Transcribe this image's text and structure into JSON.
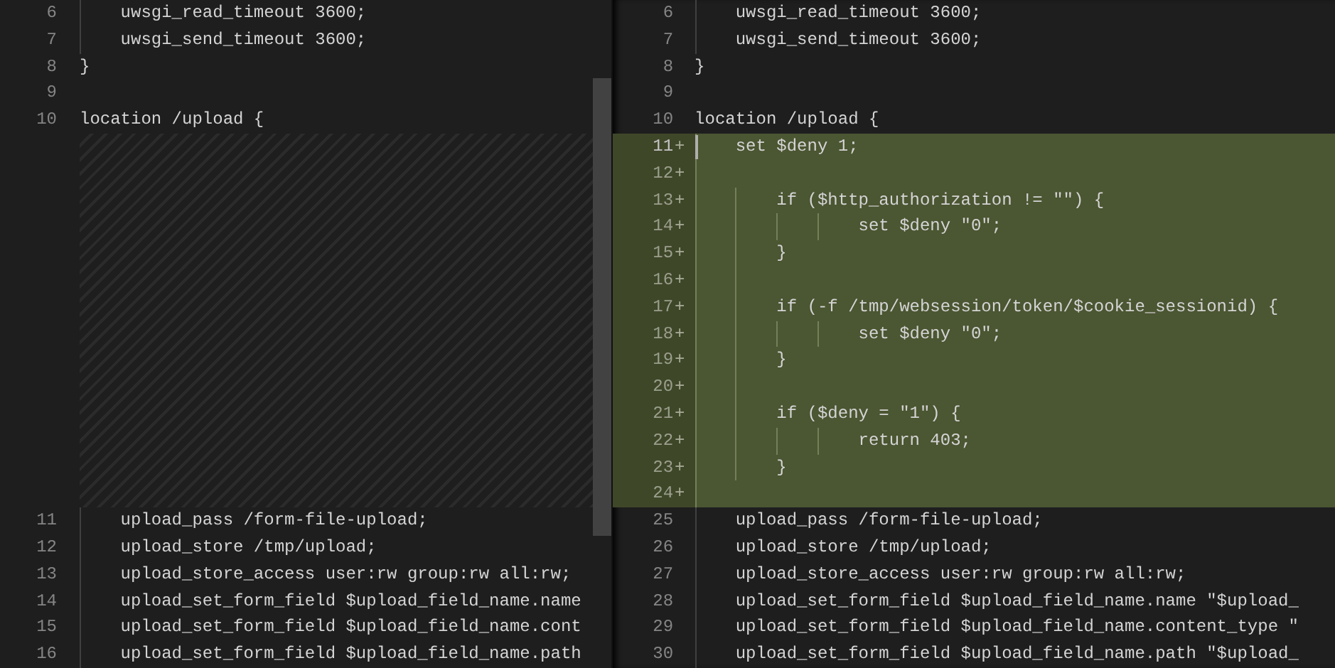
{
  "left": {
    "lines": [
      {
        "kind": "line",
        "number": "6",
        "text": "    uwsgi_read_timeout 3600;"
      },
      {
        "kind": "line",
        "number": "7",
        "text": "    uwsgi_send_timeout 3600;"
      },
      {
        "kind": "line",
        "number": "8",
        "text": "}"
      },
      {
        "kind": "line",
        "number": "9"
      },
      {
        "kind": "line",
        "number": "10",
        "text": "location /upload {"
      },
      {
        "kind": "gap"
      },
      {
        "kind": "line",
        "number": "11",
        "text": "    upload_pass /form-file-upload;"
      },
      {
        "kind": "line",
        "number": "12",
        "text": "    upload_store /tmp/upload;"
      },
      {
        "kind": "line",
        "number": "13",
        "text": "    upload_store_access user:rw group:rw all:rw;"
      },
      {
        "kind": "line",
        "number": "14",
        "text": "    upload_set_form_field $upload_field_name.name"
      },
      {
        "kind": "line",
        "number": "15",
        "text": "    upload_set_form_field $upload_field_name.cont"
      },
      {
        "kind": "line",
        "number": "16",
        "text": "    upload_set_form_field $upload_field_name.path"
      }
    ]
  },
  "right": {
    "lines": [
      {
        "number": "6",
        "text": "    uwsgi_read_timeout 3600;",
        "added": false,
        "cursor": false
      },
      {
        "number": "7",
        "text": "    uwsgi_send_timeout 3600;",
        "added": false,
        "cursor": false
      },
      {
        "number": "8",
        "text": "}",
        "added": false,
        "cursor": false
      },
      {
        "number": "9",
        "added": false,
        "cursor": false
      },
      {
        "number": "10",
        "text": "location /upload {",
        "added": false,
        "cursor": false
      },
      {
        "number": "11",
        "marker": "+",
        "text": "    set $deny 1;",
        "added": true,
        "cursor": true
      },
      {
        "number": "12",
        "marker": "+",
        "added": true,
        "cursor": false
      },
      {
        "number": "13",
        "marker": "+",
        "text": "        if ($http_authorization != \"\") {",
        "added": true,
        "cursor": false
      },
      {
        "number": "14",
        "marker": "+",
        "text": "                set $deny \"0\";",
        "added": true,
        "cursor": false
      },
      {
        "number": "15",
        "marker": "+",
        "text": "        }",
        "added": true,
        "cursor": false
      },
      {
        "number": "16",
        "marker": "+",
        "added": true,
        "cursor": false
      },
      {
        "number": "17",
        "marker": "+",
        "text": "        if (-f /tmp/websession/token/$cookie_sessionid) {",
        "added": true,
        "cursor": false
      },
      {
        "number": "18",
        "marker": "+",
        "text": "                set $deny \"0\";",
        "added": true,
        "cursor": false
      },
      {
        "number": "19",
        "marker": "+",
        "text": "        }",
        "added": true,
        "cursor": false
      },
      {
        "number": "20",
        "marker": "+",
        "added": true,
        "cursor": false
      },
      {
        "number": "21",
        "marker": "+",
        "text": "        if ($deny = \"1\") {",
        "added": true,
        "cursor": false
      },
      {
        "number": "22",
        "marker": "+",
        "text": "                return 403;",
        "added": true,
        "cursor": false
      },
      {
        "number": "23",
        "marker": "+",
        "text": "        }",
        "added": true,
        "cursor": false
      },
      {
        "number": "24",
        "marker": "+",
        "added": true,
        "cursor": false
      },
      {
        "number": "25",
        "text": "    upload_pass /form-file-upload;",
        "added": false,
        "cursor": false
      },
      {
        "number": "26",
        "text": "    upload_store /tmp/upload;",
        "added": false,
        "cursor": false
      },
      {
        "number": "27",
        "text": "    upload_store_access user:rw group:rw all:rw;",
        "added": false,
        "cursor": false
      },
      {
        "number": "28",
        "text": "    upload_set_form_field $upload_field_name.name \"$upload_",
        "added": false,
        "cursor": false
      },
      {
        "number": "29",
        "text": "    upload_set_form_field $upload_field_name.content_type \"",
        "added": false,
        "cursor": false
      },
      {
        "number": "30",
        "text": "    upload_set_form_field $upload_field_name.path \"$upload_",
        "added": false,
        "cursor": false
      }
    ]
  }
}
